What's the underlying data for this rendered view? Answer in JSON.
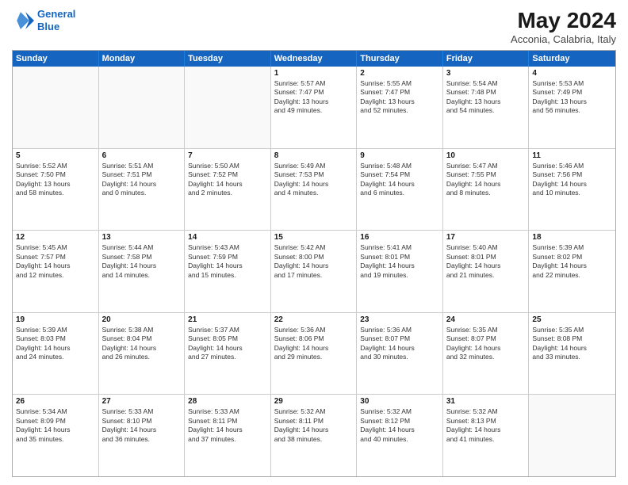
{
  "header": {
    "logo_line1": "General",
    "logo_line2": "Blue",
    "title": "May 2024",
    "subtitle": "Acconia, Calabria, Italy"
  },
  "days_of_week": [
    "Sunday",
    "Monday",
    "Tuesday",
    "Wednesday",
    "Thursday",
    "Friday",
    "Saturday"
  ],
  "weeks": [
    [
      {
        "day": "",
        "text": ""
      },
      {
        "day": "",
        "text": ""
      },
      {
        "day": "",
        "text": ""
      },
      {
        "day": "1",
        "text": "Sunrise: 5:57 AM\nSunset: 7:47 PM\nDaylight: 13 hours\nand 49 minutes."
      },
      {
        "day": "2",
        "text": "Sunrise: 5:55 AM\nSunset: 7:47 PM\nDaylight: 13 hours\nand 52 minutes."
      },
      {
        "day": "3",
        "text": "Sunrise: 5:54 AM\nSunset: 7:48 PM\nDaylight: 13 hours\nand 54 minutes."
      },
      {
        "day": "4",
        "text": "Sunrise: 5:53 AM\nSunset: 7:49 PM\nDaylight: 13 hours\nand 56 minutes."
      }
    ],
    [
      {
        "day": "5",
        "text": "Sunrise: 5:52 AM\nSunset: 7:50 PM\nDaylight: 13 hours\nand 58 minutes."
      },
      {
        "day": "6",
        "text": "Sunrise: 5:51 AM\nSunset: 7:51 PM\nDaylight: 14 hours\nand 0 minutes."
      },
      {
        "day": "7",
        "text": "Sunrise: 5:50 AM\nSunset: 7:52 PM\nDaylight: 14 hours\nand 2 minutes."
      },
      {
        "day": "8",
        "text": "Sunrise: 5:49 AM\nSunset: 7:53 PM\nDaylight: 14 hours\nand 4 minutes."
      },
      {
        "day": "9",
        "text": "Sunrise: 5:48 AM\nSunset: 7:54 PM\nDaylight: 14 hours\nand 6 minutes."
      },
      {
        "day": "10",
        "text": "Sunrise: 5:47 AM\nSunset: 7:55 PM\nDaylight: 14 hours\nand 8 minutes."
      },
      {
        "day": "11",
        "text": "Sunrise: 5:46 AM\nSunset: 7:56 PM\nDaylight: 14 hours\nand 10 minutes."
      }
    ],
    [
      {
        "day": "12",
        "text": "Sunrise: 5:45 AM\nSunset: 7:57 PM\nDaylight: 14 hours\nand 12 minutes."
      },
      {
        "day": "13",
        "text": "Sunrise: 5:44 AM\nSunset: 7:58 PM\nDaylight: 14 hours\nand 14 minutes."
      },
      {
        "day": "14",
        "text": "Sunrise: 5:43 AM\nSunset: 7:59 PM\nDaylight: 14 hours\nand 15 minutes."
      },
      {
        "day": "15",
        "text": "Sunrise: 5:42 AM\nSunset: 8:00 PM\nDaylight: 14 hours\nand 17 minutes."
      },
      {
        "day": "16",
        "text": "Sunrise: 5:41 AM\nSunset: 8:01 PM\nDaylight: 14 hours\nand 19 minutes."
      },
      {
        "day": "17",
        "text": "Sunrise: 5:40 AM\nSunset: 8:01 PM\nDaylight: 14 hours\nand 21 minutes."
      },
      {
        "day": "18",
        "text": "Sunrise: 5:39 AM\nSunset: 8:02 PM\nDaylight: 14 hours\nand 22 minutes."
      }
    ],
    [
      {
        "day": "19",
        "text": "Sunrise: 5:39 AM\nSunset: 8:03 PM\nDaylight: 14 hours\nand 24 minutes."
      },
      {
        "day": "20",
        "text": "Sunrise: 5:38 AM\nSunset: 8:04 PM\nDaylight: 14 hours\nand 26 minutes."
      },
      {
        "day": "21",
        "text": "Sunrise: 5:37 AM\nSunset: 8:05 PM\nDaylight: 14 hours\nand 27 minutes."
      },
      {
        "day": "22",
        "text": "Sunrise: 5:36 AM\nSunset: 8:06 PM\nDaylight: 14 hours\nand 29 minutes."
      },
      {
        "day": "23",
        "text": "Sunrise: 5:36 AM\nSunset: 8:07 PM\nDaylight: 14 hours\nand 30 minutes."
      },
      {
        "day": "24",
        "text": "Sunrise: 5:35 AM\nSunset: 8:07 PM\nDaylight: 14 hours\nand 32 minutes."
      },
      {
        "day": "25",
        "text": "Sunrise: 5:35 AM\nSunset: 8:08 PM\nDaylight: 14 hours\nand 33 minutes."
      }
    ],
    [
      {
        "day": "26",
        "text": "Sunrise: 5:34 AM\nSunset: 8:09 PM\nDaylight: 14 hours\nand 35 minutes."
      },
      {
        "day": "27",
        "text": "Sunrise: 5:33 AM\nSunset: 8:10 PM\nDaylight: 14 hours\nand 36 minutes."
      },
      {
        "day": "28",
        "text": "Sunrise: 5:33 AM\nSunset: 8:11 PM\nDaylight: 14 hours\nand 37 minutes."
      },
      {
        "day": "29",
        "text": "Sunrise: 5:32 AM\nSunset: 8:11 PM\nDaylight: 14 hours\nand 38 minutes."
      },
      {
        "day": "30",
        "text": "Sunrise: 5:32 AM\nSunset: 8:12 PM\nDaylight: 14 hours\nand 40 minutes."
      },
      {
        "day": "31",
        "text": "Sunrise: 5:32 AM\nSunset: 8:13 PM\nDaylight: 14 hours\nand 41 minutes."
      },
      {
        "day": "",
        "text": ""
      }
    ]
  ]
}
